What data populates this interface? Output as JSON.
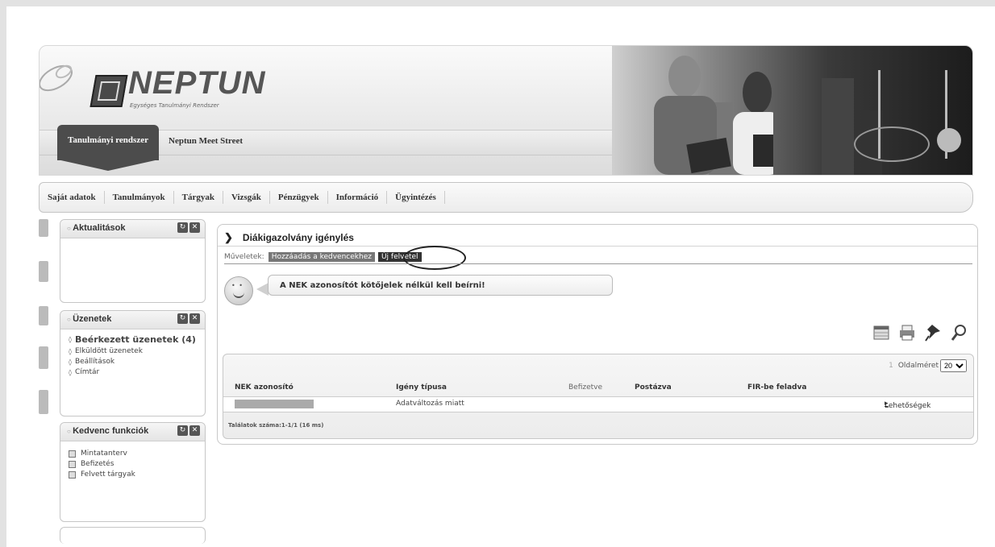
{
  "header": {
    "logo_text": "NEPTUN",
    "logo_subtitle": "Egységes Tanulmányi Rendszer",
    "tabs": [
      {
        "label": "Tanulmányi rendszer"
      },
      {
        "label": "Neptun Meet Street"
      }
    ]
  },
  "nav": {
    "items": [
      {
        "label": "Saját adatok"
      },
      {
        "label": "Tanulmányok"
      },
      {
        "label": "Tárgyak"
      },
      {
        "label": "Vizsgák"
      },
      {
        "label": "Pénzügyek"
      },
      {
        "label": "Információ"
      },
      {
        "label": "Ügyintézés"
      }
    ]
  },
  "sidebar": {
    "news": {
      "title": "Aktualitások"
    },
    "messages": {
      "title": "Üzenetek",
      "items": [
        {
          "label": "Beérkezett üzenetek (4)"
        },
        {
          "label": "Elküldött üzenetek"
        },
        {
          "label": "Beállítások"
        },
        {
          "label": "Címtár"
        }
      ]
    },
    "favorites": {
      "title": "Kedvenc funkciók",
      "items": [
        {
          "label": "Mintatanterv"
        },
        {
          "label": "Befizetés"
        },
        {
          "label": "Felvett tárgyak"
        }
      ]
    }
  },
  "main": {
    "title": "Diákigazolvány igénylés",
    "ops_label": "Műveletek:",
    "ops": [
      {
        "label": "Hozzáadás a kedvencekhez"
      },
      {
        "label": "Új felvétel"
      }
    ],
    "message": "A NEK azonosítót kötőjelek nélkül kell beírni!",
    "pager": {
      "page": "1",
      "label": "Oldalméret",
      "size": "20"
    },
    "table": {
      "columns": [
        "NEK azonosító",
        "Igény típusa",
        "Befizetve",
        "Postázva",
        "FIR-be feladva"
      ],
      "rows": [
        {
          "type": "Adatváltozás miatt",
          "action": "Lehetőségek"
        }
      ],
      "footer": "Találatok száma:1-1/1 (16 ms)"
    }
  },
  "colors": {
    "accent": "#4c4c4c",
    "background": "#ffffff"
  }
}
